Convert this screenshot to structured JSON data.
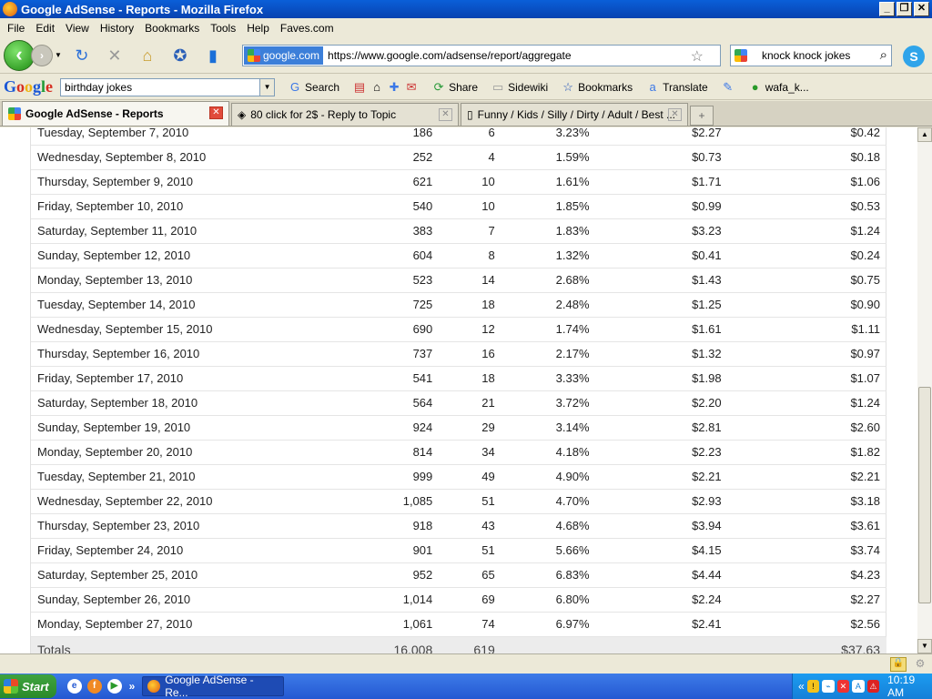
{
  "window": {
    "title": "Google AdSense - Reports - Mozilla Firefox"
  },
  "menu": [
    "File",
    "Edit",
    "View",
    "History",
    "Bookmarks",
    "Tools",
    "Help",
    "Faves.com"
  ],
  "address": {
    "site": "google.com",
    "url": "https://www.google.com/adsense/report/aggregate"
  },
  "search": {
    "value": "knock knock jokes"
  },
  "google_toolbar": {
    "logo": "Google",
    "query": "birthday jokes",
    "search_label": "Search",
    "share_label": "Share",
    "sidewiki_label": "Sidewiki",
    "bookmarks_label": "Bookmarks",
    "translate_label": "Translate",
    "user_label": "wafa_k..."
  },
  "tabs": [
    {
      "title": "Google AdSense - Reports"
    },
    {
      "title": "80 click for 2$ - Reply to Topic"
    },
    {
      "title": "Funny / Kids / Silly / Dirty / Adult / Best ..."
    }
  ],
  "report": {
    "rows": [
      {
        "date": "Tuesday, September 7, 2010",
        "views": "186",
        "clicks": "6",
        "ctr": "3.23%",
        "cpc": "$2.27",
        "earnings": "$0.42"
      },
      {
        "date": "Wednesday, September 8, 2010",
        "views": "252",
        "clicks": "4",
        "ctr": "1.59%",
        "cpc": "$0.73",
        "earnings": "$0.18"
      },
      {
        "date": "Thursday, September 9, 2010",
        "views": "621",
        "clicks": "10",
        "ctr": "1.61%",
        "cpc": "$1.71",
        "earnings": "$1.06"
      },
      {
        "date": "Friday, September 10, 2010",
        "views": "540",
        "clicks": "10",
        "ctr": "1.85%",
        "cpc": "$0.99",
        "earnings": "$0.53"
      },
      {
        "date": "Saturday, September 11, 2010",
        "views": "383",
        "clicks": "7",
        "ctr": "1.83%",
        "cpc": "$3.23",
        "earnings": "$1.24"
      },
      {
        "date": "Sunday, September 12, 2010",
        "views": "604",
        "clicks": "8",
        "ctr": "1.32%",
        "cpc": "$0.41",
        "earnings": "$0.24"
      },
      {
        "date": "Monday, September 13, 2010",
        "views": "523",
        "clicks": "14",
        "ctr": "2.68%",
        "cpc": "$1.43",
        "earnings": "$0.75"
      },
      {
        "date": "Tuesday, September 14, 2010",
        "views": "725",
        "clicks": "18",
        "ctr": "2.48%",
        "cpc": "$1.25",
        "earnings": "$0.90"
      },
      {
        "date": "Wednesday, September 15, 2010",
        "views": "690",
        "clicks": "12",
        "ctr": "1.74%",
        "cpc": "$1.61",
        "earnings": "$1.11"
      },
      {
        "date": "Thursday, September 16, 2010",
        "views": "737",
        "clicks": "16",
        "ctr": "2.17%",
        "cpc": "$1.32",
        "earnings": "$0.97"
      },
      {
        "date": "Friday, September 17, 2010",
        "views": "541",
        "clicks": "18",
        "ctr": "3.33%",
        "cpc": "$1.98",
        "earnings": "$1.07"
      },
      {
        "date": "Saturday, September 18, 2010",
        "views": "564",
        "clicks": "21",
        "ctr": "3.72%",
        "cpc": "$2.20",
        "earnings": "$1.24"
      },
      {
        "date": "Sunday, September 19, 2010",
        "views": "924",
        "clicks": "29",
        "ctr": "3.14%",
        "cpc": "$2.81",
        "earnings": "$2.60"
      },
      {
        "date": "Monday, September 20, 2010",
        "views": "814",
        "clicks": "34",
        "ctr": "4.18%",
        "cpc": "$2.23",
        "earnings": "$1.82"
      },
      {
        "date": "Tuesday, September 21, 2010",
        "views": "999",
        "clicks": "49",
        "ctr": "4.90%",
        "cpc": "$2.21",
        "earnings": "$2.21"
      },
      {
        "date": "Wednesday, September 22, 2010",
        "views": "1,085",
        "clicks": "51",
        "ctr": "4.70%",
        "cpc": "$2.93",
        "earnings": "$3.18"
      },
      {
        "date": "Thursday, September 23, 2010",
        "views": "918",
        "clicks": "43",
        "ctr": "4.68%",
        "cpc": "$3.94",
        "earnings": "$3.61"
      },
      {
        "date": "Friday, September 24, 2010",
        "views": "901",
        "clicks": "51",
        "ctr": "5.66%",
        "cpc": "$4.15",
        "earnings": "$3.74"
      },
      {
        "date": "Saturday, September 25, 2010",
        "views": "952",
        "clicks": "65",
        "ctr": "6.83%",
        "cpc": "$4.44",
        "earnings": "$4.23"
      },
      {
        "date": "Sunday, September 26, 2010",
        "views": "1,014",
        "clicks": "69",
        "ctr": "6.80%",
        "cpc": "$2.24",
        "earnings": "$2.27"
      },
      {
        "date": "Monday, September 27, 2010",
        "views": "1,061",
        "clicks": "74",
        "ctr": "6.97%",
        "cpc": "$2.41",
        "earnings": "$2.56"
      }
    ],
    "totals": {
      "label": "Totals",
      "views": "16,008",
      "clicks": "619",
      "earnings": "$37.63"
    }
  },
  "taskbar": {
    "start": "Start",
    "task": "Google AdSense - Re...",
    "clock": "10:19 AM"
  }
}
